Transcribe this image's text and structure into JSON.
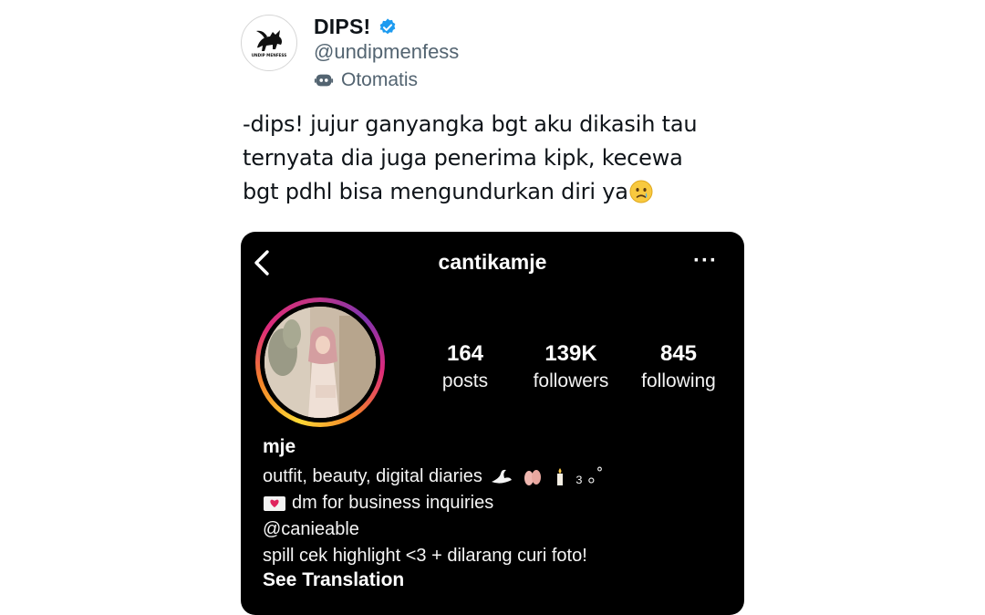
{
  "tweet": {
    "author_name": "DIPS!",
    "handle": "@undipmenfess",
    "automated_label": "Otomatis",
    "avatar_caption": "UNDIP MENFESS",
    "text": "-dips! jujur ganyangka bgt aku dikasih tau\nternyata dia juga penerima kipk, kecewa\nbgt pdhl bisa mengundurkan diri ya",
    "text_emoji": "crying-face-emoji",
    "verified_icon": "verified-badge-icon",
    "colors": {
      "verified": "#1d9bf0",
      "secondary_text": "#536471"
    }
  },
  "instagram": {
    "username": "cantikamje",
    "more_label": "···",
    "stats": [
      {
        "value": "164",
        "label": "posts"
      },
      {
        "value": "139K",
        "label": "followers"
      },
      {
        "value": "845",
        "label": "following"
      }
    ],
    "display_name": "mje",
    "bio": {
      "line1": "outfit, beauty, digital diaries",
      "line1_suffix": "₃ ｡˚",
      "line2": "dm for business inquiries",
      "line3": "@canieable",
      "line4": "spill cek highlight <3 + dilarang curi foto!"
    },
    "see_translation": "See Translation",
    "colors": {
      "background": "#000000",
      "text": "#ffffff"
    }
  }
}
